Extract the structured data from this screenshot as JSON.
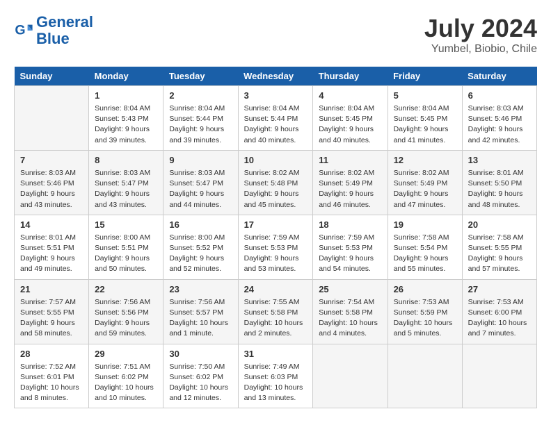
{
  "header": {
    "logo_line1": "General",
    "logo_line2": "Blue",
    "month_year": "July 2024",
    "location": "Yumbel, Biobio, Chile"
  },
  "weekdays": [
    "Sunday",
    "Monday",
    "Tuesday",
    "Wednesday",
    "Thursday",
    "Friday",
    "Saturday"
  ],
  "weeks": [
    [
      {
        "day": "",
        "info": ""
      },
      {
        "day": "1",
        "info": "Sunrise: 8:04 AM\nSunset: 5:43 PM\nDaylight: 9 hours\nand 39 minutes."
      },
      {
        "day": "2",
        "info": "Sunrise: 8:04 AM\nSunset: 5:44 PM\nDaylight: 9 hours\nand 39 minutes."
      },
      {
        "day": "3",
        "info": "Sunrise: 8:04 AM\nSunset: 5:44 PM\nDaylight: 9 hours\nand 40 minutes."
      },
      {
        "day": "4",
        "info": "Sunrise: 8:04 AM\nSunset: 5:45 PM\nDaylight: 9 hours\nand 40 minutes."
      },
      {
        "day": "5",
        "info": "Sunrise: 8:04 AM\nSunset: 5:45 PM\nDaylight: 9 hours\nand 41 minutes."
      },
      {
        "day": "6",
        "info": "Sunrise: 8:03 AM\nSunset: 5:46 PM\nDaylight: 9 hours\nand 42 minutes."
      }
    ],
    [
      {
        "day": "7",
        "info": "Sunrise: 8:03 AM\nSunset: 5:46 PM\nDaylight: 9 hours\nand 43 minutes."
      },
      {
        "day": "8",
        "info": "Sunrise: 8:03 AM\nSunset: 5:47 PM\nDaylight: 9 hours\nand 43 minutes."
      },
      {
        "day": "9",
        "info": "Sunrise: 8:03 AM\nSunset: 5:47 PM\nDaylight: 9 hours\nand 44 minutes."
      },
      {
        "day": "10",
        "info": "Sunrise: 8:02 AM\nSunset: 5:48 PM\nDaylight: 9 hours\nand 45 minutes."
      },
      {
        "day": "11",
        "info": "Sunrise: 8:02 AM\nSunset: 5:49 PM\nDaylight: 9 hours\nand 46 minutes."
      },
      {
        "day": "12",
        "info": "Sunrise: 8:02 AM\nSunset: 5:49 PM\nDaylight: 9 hours\nand 47 minutes."
      },
      {
        "day": "13",
        "info": "Sunrise: 8:01 AM\nSunset: 5:50 PM\nDaylight: 9 hours\nand 48 minutes."
      }
    ],
    [
      {
        "day": "14",
        "info": "Sunrise: 8:01 AM\nSunset: 5:51 PM\nDaylight: 9 hours\nand 49 minutes."
      },
      {
        "day": "15",
        "info": "Sunrise: 8:00 AM\nSunset: 5:51 PM\nDaylight: 9 hours\nand 50 minutes."
      },
      {
        "day": "16",
        "info": "Sunrise: 8:00 AM\nSunset: 5:52 PM\nDaylight: 9 hours\nand 52 minutes."
      },
      {
        "day": "17",
        "info": "Sunrise: 7:59 AM\nSunset: 5:53 PM\nDaylight: 9 hours\nand 53 minutes."
      },
      {
        "day": "18",
        "info": "Sunrise: 7:59 AM\nSunset: 5:53 PM\nDaylight: 9 hours\nand 54 minutes."
      },
      {
        "day": "19",
        "info": "Sunrise: 7:58 AM\nSunset: 5:54 PM\nDaylight: 9 hours\nand 55 minutes."
      },
      {
        "day": "20",
        "info": "Sunrise: 7:58 AM\nSunset: 5:55 PM\nDaylight: 9 hours\nand 57 minutes."
      }
    ],
    [
      {
        "day": "21",
        "info": "Sunrise: 7:57 AM\nSunset: 5:55 PM\nDaylight: 9 hours\nand 58 minutes."
      },
      {
        "day": "22",
        "info": "Sunrise: 7:56 AM\nSunset: 5:56 PM\nDaylight: 9 hours\nand 59 minutes."
      },
      {
        "day": "23",
        "info": "Sunrise: 7:56 AM\nSunset: 5:57 PM\nDaylight: 10 hours\nand 1 minute."
      },
      {
        "day": "24",
        "info": "Sunrise: 7:55 AM\nSunset: 5:58 PM\nDaylight: 10 hours\nand 2 minutes."
      },
      {
        "day": "25",
        "info": "Sunrise: 7:54 AM\nSunset: 5:58 PM\nDaylight: 10 hours\nand 4 minutes."
      },
      {
        "day": "26",
        "info": "Sunrise: 7:53 AM\nSunset: 5:59 PM\nDaylight: 10 hours\nand 5 minutes."
      },
      {
        "day": "27",
        "info": "Sunrise: 7:53 AM\nSunset: 6:00 PM\nDaylight: 10 hours\nand 7 minutes."
      }
    ],
    [
      {
        "day": "28",
        "info": "Sunrise: 7:52 AM\nSunset: 6:01 PM\nDaylight: 10 hours\nand 8 minutes."
      },
      {
        "day": "29",
        "info": "Sunrise: 7:51 AM\nSunset: 6:02 PM\nDaylight: 10 hours\nand 10 minutes."
      },
      {
        "day": "30",
        "info": "Sunrise: 7:50 AM\nSunset: 6:02 PM\nDaylight: 10 hours\nand 12 minutes."
      },
      {
        "day": "31",
        "info": "Sunrise: 7:49 AM\nSunset: 6:03 PM\nDaylight: 10 hours\nand 13 minutes."
      },
      {
        "day": "",
        "info": ""
      },
      {
        "day": "",
        "info": ""
      },
      {
        "day": "",
        "info": ""
      }
    ]
  ]
}
